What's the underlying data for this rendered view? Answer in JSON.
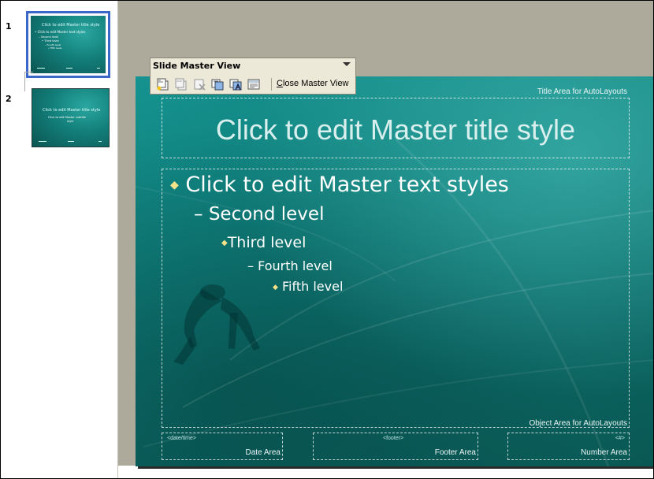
{
  "thumbnails": [
    {
      "number": "1",
      "title": "Click to edit Master title style",
      "lines": [
        "• Click to edit Master text styles",
        "– Second level",
        "• Third level",
        "– Fourth level",
        "» Fifth level"
      ]
    },
    {
      "number": "2",
      "title": "Click to edit Master title style",
      "lines": [
        "Click to edit Master subtitle",
        "style"
      ]
    }
  ],
  "toolbar": {
    "title": "Slide Master View",
    "close_label_accel": "C",
    "close_label_rest": "lose Master View",
    "icons": [
      "insert-new-slide-master-icon",
      "insert-new-title-master-icon",
      "delete-master-icon",
      "preserve-master-icon",
      "rename-master-icon",
      "master-layout-icon"
    ]
  },
  "slide": {
    "title_area_label": "Title Area for AutoLayouts",
    "title_text": "Click to edit Master title style",
    "levels": [
      {
        "bullet": "◆",
        "text": "Click to edit Master text styles"
      },
      {
        "bullet": "–",
        "text": "Second level"
      },
      {
        "bullet": "◆",
        "text": "Third level"
      },
      {
        "bullet": "–",
        "text": "Fourth level"
      },
      {
        "bullet": "◆",
        "text": "Fifth level"
      }
    ],
    "object_area_label": "Object Area for AutoLayouts",
    "date_placeholder": "<date/time>",
    "date_label": "Date Area",
    "footer_placeholder": "<footer>",
    "footer_label": "Footer Area",
    "number_placeholder": "<#>",
    "number_label": "Number Area"
  },
  "colors": {
    "slide_teal": "#0f7d79",
    "selection_blue": "#3a68c8",
    "workspace_gray": "#ada99b",
    "toolbar_bg": "#ece9d8",
    "bullet_gold": "#f3e28a"
  }
}
